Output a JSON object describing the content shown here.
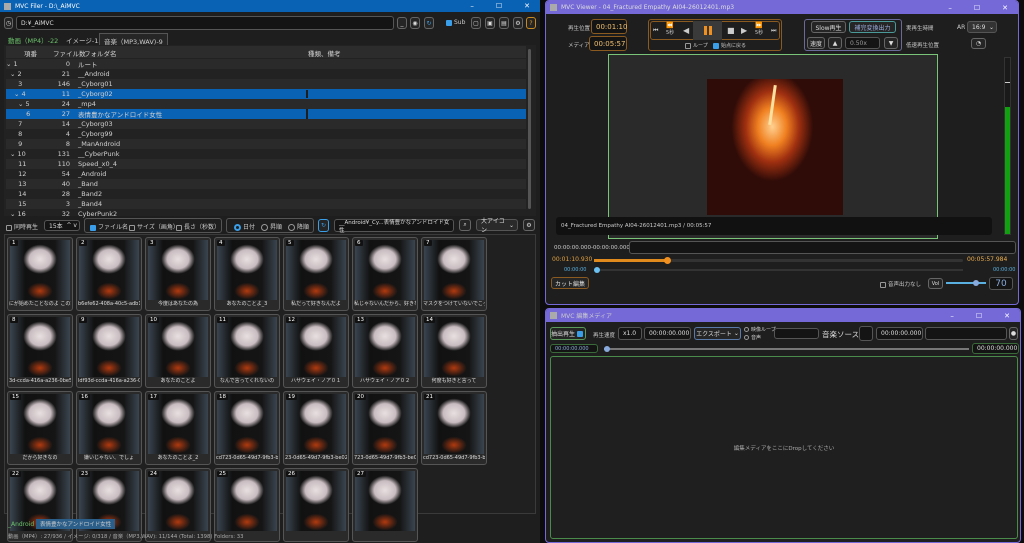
{
  "filer": {
    "title": "MVC Filer - D:\\_AiMVC",
    "path": "D:¥_AiMVC",
    "sub_label": "Sub",
    "tabs": [
      "動画（MP4）-22",
      "イメージ-15",
      "音楽（MP3,WAV)-9"
    ],
    "columns": [
      "項番",
      "ファイル数",
      "フォルダ名",
      "種類、備考"
    ],
    "rows": [
      {
        "n": "1",
        "c": "0",
        "f": "ルート",
        "exp": true,
        "d": 0
      },
      {
        "n": "2",
        "c": "21",
        "f": "__Android",
        "exp": true,
        "d": 1
      },
      {
        "n": "3",
        "c": "146",
        "f": "_Cyborg01",
        "d": 2
      },
      {
        "n": "4",
        "c": "11",
        "f": "_Cyborg02",
        "exp": true,
        "d": 2,
        "sel": true
      },
      {
        "n": "5",
        "c": "24",
        "f": "_mp4",
        "exp": true,
        "d": 3
      },
      {
        "n": "6",
        "c": "27",
        "f": "表情豊かなアンドロイド女性",
        "d": 4,
        "sel": true
      },
      {
        "n": "7",
        "c": "14",
        "f": "_Cyborg03",
        "d": 2
      },
      {
        "n": "8",
        "c": "4",
        "f": "_Cyborg99",
        "d": 2
      },
      {
        "n": "9",
        "c": "8",
        "f": "_ManAndroid",
        "d": 2
      },
      {
        "n": "10",
        "c": "131",
        "f": "__CyberPunk",
        "exp": true,
        "d": 1
      },
      {
        "n": "11",
        "c": "110",
        "f": "Speed_x0_4",
        "d": 2
      },
      {
        "n": "12",
        "c": "54",
        "f": "_Android",
        "d": 2
      },
      {
        "n": "13",
        "c": "40",
        "f": "_Band",
        "d": 2
      },
      {
        "n": "14",
        "c": "28",
        "f": "_Band2",
        "d": 2
      },
      {
        "n": "15",
        "c": "3",
        "f": "_Band4",
        "d": 2
      },
      {
        "n": "16",
        "c": "32",
        "f": "CyberPunk2",
        "exp": true,
        "d": 1
      }
    ],
    "options": {
      "sync_play": "同時再生",
      "count": "15本",
      "file_name": "ファイル名",
      "size": "サイズ（画角）",
      "length": "長さ（秒数）",
      "date": "日付",
      "asc": "昇順",
      "desc": "降順",
      "folder_path": "__Android¥_Cy...表情豊かなアンドロイド女性",
      "view": "大アイコン"
    },
    "thumbs": [
      "にが始めたことなのよ この計画",
      "b6efe62-408a-40c5-adb1-a",
      "今度はあなたの為",
      "あなたのことよ_3",
      "私だって好きなんだよ",
      "私じゃないんだから、好きなのは",
      "マスクをつけていないでこっちを!",
      "3d-ccda-416a-a236-0be5c",
      "ldf93d-ccda-416a-a236-0b",
      "あなたのことよ",
      "なんで言ってくれないの",
      "ハサウェイ・ノア０１",
      "ハサウェイ・ノア０２",
      "何度も好きと言って",
      "だから好きなの",
      "嫌いじゃない、でしょ",
      "あなたのことよ_2",
      "cd723-0d65-49d7-9fb3-be",
      "23-0d65-49d7-9fb3-be021",
      "723-0d65-49d7-9fb3-be0",
      "cd723-0d65-49d7-9fb3-be",
      "",
      "",
      "",
      "",
      "",
      ""
    ],
    "crumbs": [
      "_Android",
      "表情豊かなアンドロイド女性"
    ],
    "status": "動画（MP4）: 27/936 / イメージ: 0/318 / 音楽（MP3,WAV): 11/144   (Total: 1398)   Folders: 33"
  },
  "viewer": {
    "title": "MVC Viewer - 04_Fractured Empathy AI04-26012401.mp3",
    "pos_label": "再生位置",
    "pos": "00:01:10",
    "media_label": "メディア",
    "media": "00:05:57",
    "skip5": "5秒",
    "loop": "ループ",
    "return": "始点に戻る",
    "slow": "Slow再生",
    "interp": "補完変換出力",
    "speed": "速度",
    "speed_val": "0.50x",
    "real_time": "実再生時間",
    "low_pos": "低速再生位置",
    "ar_label": "AR",
    "ar": "16:9",
    "caption": "04_Fractured Empathy AI04-26012401.mp3 / 00:05:57",
    "range": "00:00:00.000-00:00:00.000",
    "cur": "00:01:10.930",
    "end": "00:05:57.984",
    "sub_cur": "00:00:00",
    "sub_end": "00:00:00",
    "progress": 0.198,
    "cut": "カット編集",
    "mute": "音声出力なし",
    "vol": "Vol",
    "vol_val": "70",
    "level": 0.72
  },
  "editor": {
    "title": "MVC 編集メディア",
    "batch": "抽出再生",
    "rate_label": "再生速度",
    "rate": "x1.0",
    "t1": "00:00:00.000",
    "export": "エクスポート",
    "vloop": "映像ループ",
    "audio": "音声",
    "music": "音楽ソース：",
    "t2": "00:00:00.000",
    "s1": "00:00:00.000",
    "s2": "00:00:00.000",
    "drop": "編集メディアをここにDropしてください"
  },
  "colors": {
    "filer_title": "#0a62b4",
    "viewer_title": "#7569d8",
    "accent": "#e08a1e"
  }
}
